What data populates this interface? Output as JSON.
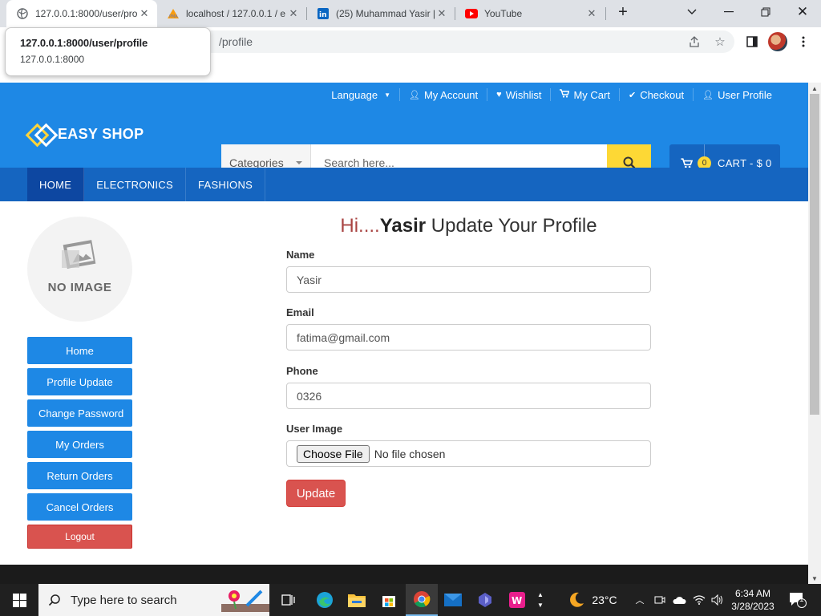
{
  "browser": {
    "tabs": [
      {
        "title": "127.0.0.1:8000/user/pro",
        "active": true
      },
      {
        "title": "localhost / 127.0.0.1 / e",
        "active": false
      },
      {
        "title": "(25) Muhammad Yasir |",
        "active": false
      },
      {
        "title": "YouTube",
        "active": false
      }
    ],
    "new_tab_label": "+",
    "url_visible": "/profile",
    "hover_card": {
      "title": "127.0.0.1:8000/user/profile",
      "host": "127.0.0.1:8000"
    }
  },
  "header": {
    "top_links": [
      {
        "label": "Language",
        "icon": "chevron-down-icon"
      },
      {
        "label": "My Account",
        "icon": "user-icon"
      },
      {
        "label": "Wishlist",
        "icon": "heart-icon"
      },
      {
        "label": "My Cart",
        "icon": "cart-icon"
      },
      {
        "label": "Checkout",
        "icon": "check-icon"
      },
      {
        "label": "User Profile",
        "icon": "user-icon"
      }
    ],
    "logo": "EASY SHOP",
    "search": {
      "category": "Categories",
      "placeholder": "Search here..."
    },
    "cart": {
      "count": "0",
      "label": "CART - $ 0"
    },
    "nav": [
      "HOME",
      "ELECTRONICS",
      "FASHIONS"
    ]
  },
  "sidebar": {
    "no_image_caption": "NO IMAGE",
    "buttons": [
      "Home",
      "Profile Update",
      "Change Password",
      "My Orders",
      "Return Orders",
      "Cancel Orders"
    ],
    "logout": "Logout"
  },
  "form": {
    "heading_prefix": "Hi....",
    "heading_name": "Yasir",
    "heading_suffix": " Update Your Profile",
    "name_label": "Name",
    "name_value": "Yasir",
    "email_label": "Email",
    "email_value": "fatima@gmail.com",
    "phone_label": "Phone",
    "phone_value": "0326",
    "image_label": "User Image",
    "choose_file": "Choose File",
    "no_file": "No file chosen",
    "submit": "Update"
  },
  "taskbar": {
    "search_placeholder": "Type here to search",
    "weather": "23°C",
    "time": "6:34 AM",
    "date": "3/28/2023",
    "notifications": "1"
  },
  "colors": {
    "primary": "#1e88e5",
    "nav": "#1565c0",
    "accent": "#fdd835",
    "danger": "#d9534f"
  }
}
